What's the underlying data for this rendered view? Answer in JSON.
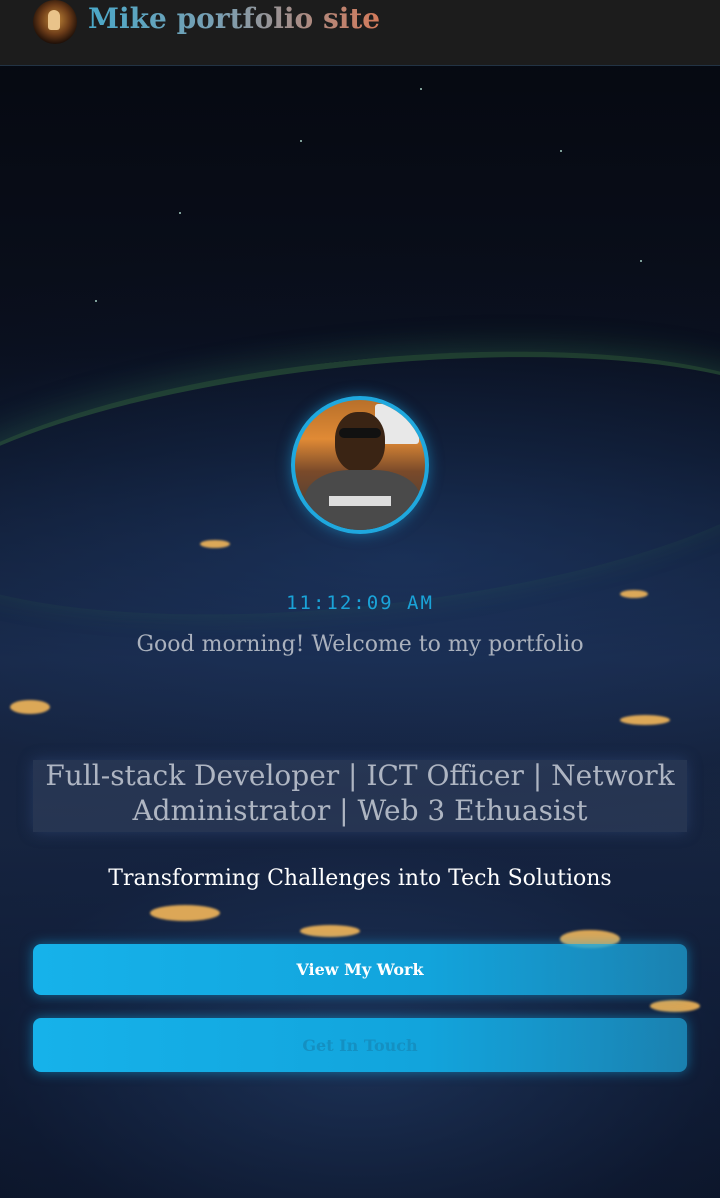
{
  "header": {
    "site_title": "Mike portfolio site",
    "logo_icon": "avatar-logo-icon"
  },
  "hero": {
    "clock": "11:12:09 AM",
    "greeting": "Good morning! Welcome to my portfolio",
    "roles": "Full-stack Developer | ICT Officer | Network Administrator | Web 3 Ethuasist",
    "tagline": "Transforming Challenges into Tech Solutions",
    "primary_button": "View My Work",
    "secondary_button": "Get In Touch"
  },
  "colors": {
    "accent": "#1aa3d8",
    "header_bg": "#1c1c1c",
    "button": "#16b2ea"
  }
}
